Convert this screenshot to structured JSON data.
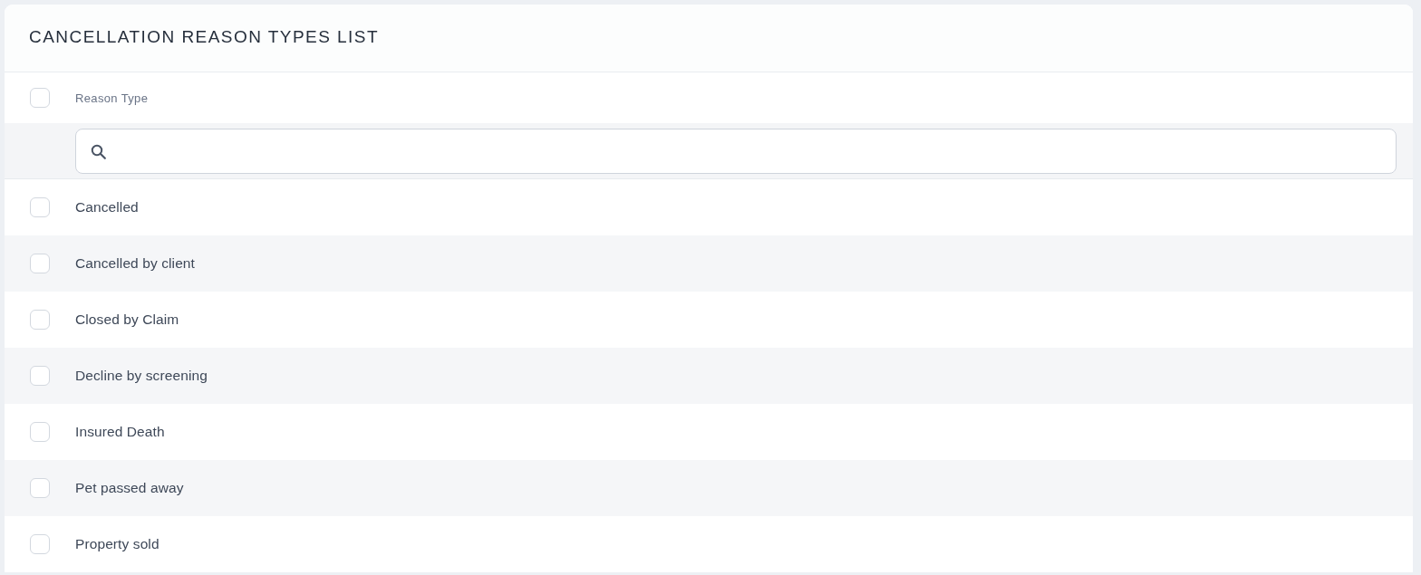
{
  "page": {
    "title": "CANCELLATION REASON TYPES LIST"
  },
  "table": {
    "select_all": {
      "checked": false
    },
    "columns": [
      {
        "label": "Reason Type"
      }
    ],
    "rows": [
      {
        "reason_type": "Cancelled",
        "checked": false
      },
      {
        "reason_type": "Cancelled by client",
        "checked": false
      },
      {
        "reason_type": "Closed by Claim",
        "checked": false
      },
      {
        "reason_type": "Decline by screening",
        "checked": false
      },
      {
        "reason_type": "Insured Death",
        "checked": false
      },
      {
        "reason_type": "Pet passed away",
        "checked": false
      },
      {
        "reason_type": "Property sold",
        "checked": false
      }
    ]
  }
}
